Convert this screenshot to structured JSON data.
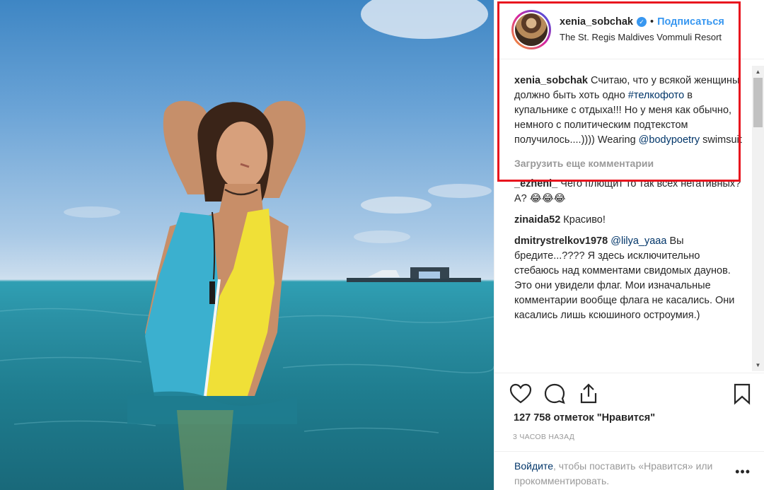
{
  "post": {
    "username": "xenia_sobchak",
    "follow_label": "Подписаться",
    "separator": "•",
    "location": "The St. Regis Maldives Vommuli Resort",
    "verified_icon": "✓"
  },
  "caption": {
    "user": "xenia_sobchak",
    "text1": " Считаю, что у всякой женщины должно быть хоть одно ",
    "hashtag": "#телкофото",
    "text2": " в купальнике с отдыха!!! Но у меня как обычно, немного с политическим подтекстом получилось....)))) Wearing ",
    "mention": "@bodypoetry",
    "text3": " swimsuit"
  },
  "load_more": "Загрузить еще комментарии",
  "comments": [
    {
      "user": "_ezheni_",
      "text": " Чего плющит то так всех негативных? А? 😂😂😂"
    },
    {
      "user": "zinaida52",
      "text": " Красиво!"
    },
    {
      "user": "dmitrystrelkov1978",
      "mention": "@lilya_yaaa",
      "text": " Вы бредите...???? Я здесь исключительно стебаюсь над комментами свидомых даунов. Это они увидели флаг. Мои изначальные комментарии вообще флага не касались. Они касались лишь ксюшиного остроумия.)"
    }
  ],
  "likes": "127 758 отметок \"Нравится\"",
  "time": "3 ЧАСОВ НАЗАД",
  "footer": {
    "login": "Войдите",
    "rest": ", чтобы поставить «Нравится» или прокомментировать.",
    "more": "•••"
  },
  "colors": {
    "accent": "#3897f0",
    "highlight_box": "#e8141e",
    "link": "#003569"
  }
}
